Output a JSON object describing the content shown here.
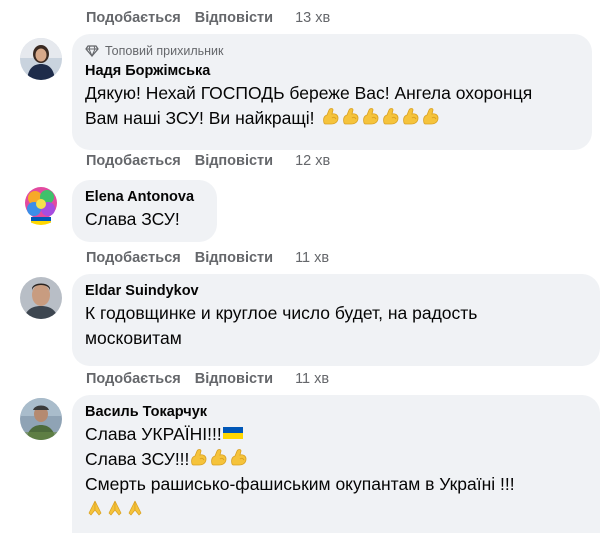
{
  "top_actions": {
    "like": "Подобається",
    "reply": "Відповісти",
    "time": "13 хв"
  },
  "comments": [
    {
      "badge": "Топовий прихильник",
      "name": "Надя Боржімська",
      "line1": "Дякую! Нехай ГОСПОДЬ береже Вас! Ангела охоронця",
      "line2": "Вам наші ЗСУ! Ви найкращі!",
      "reactions": "💪💪💪💪💪💪",
      "like": "Подобається",
      "reply": "Відповісти",
      "time": "12 хв"
    },
    {
      "name": "Elena Antonova",
      "line1": "Слава ЗСУ!",
      "like": "Подобається",
      "reply": "Відповісти",
      "time": "11 хв"
    },
    {
      "name": "Eldar Suindykov",
      "line1": "К годовщинке и круглое число будет, на радость",
      "line2": "московитам",
      "like": "Подобається",
      "reply": "Відповісти",
      "time": "11 хв"
    },
    {
      "name": "Василь Токарчук",
      "line1": "Слава УКРАЇНІ!!!",
      "line1_emoji": "🇺🇦",
      "line2": "Слава ЗСУ!!!",
      "line2_emoji": "💪💪💪",
      "line3": "Смерть рашисько-фашиським окупантам в Україні !!!",
      "line4": "🙏🙏🙏"
    }
  ],
  "icons": {
    "badge": "diamond-icon",
    "flex": "flexed-biceps-emoji",
    "flag": "ukraine-flag-emoji",
    "pray": "folded-hands-emoji"
  },
  "colors": {
    "meta_text": "#65676b",
    "bubble_bg": "#f0f2f5",
    "emoji_yellow": "#f5c33b",
    "flag_blue": "#0057b7",
    "flag_yellow": "#ffd700"
  }
}
